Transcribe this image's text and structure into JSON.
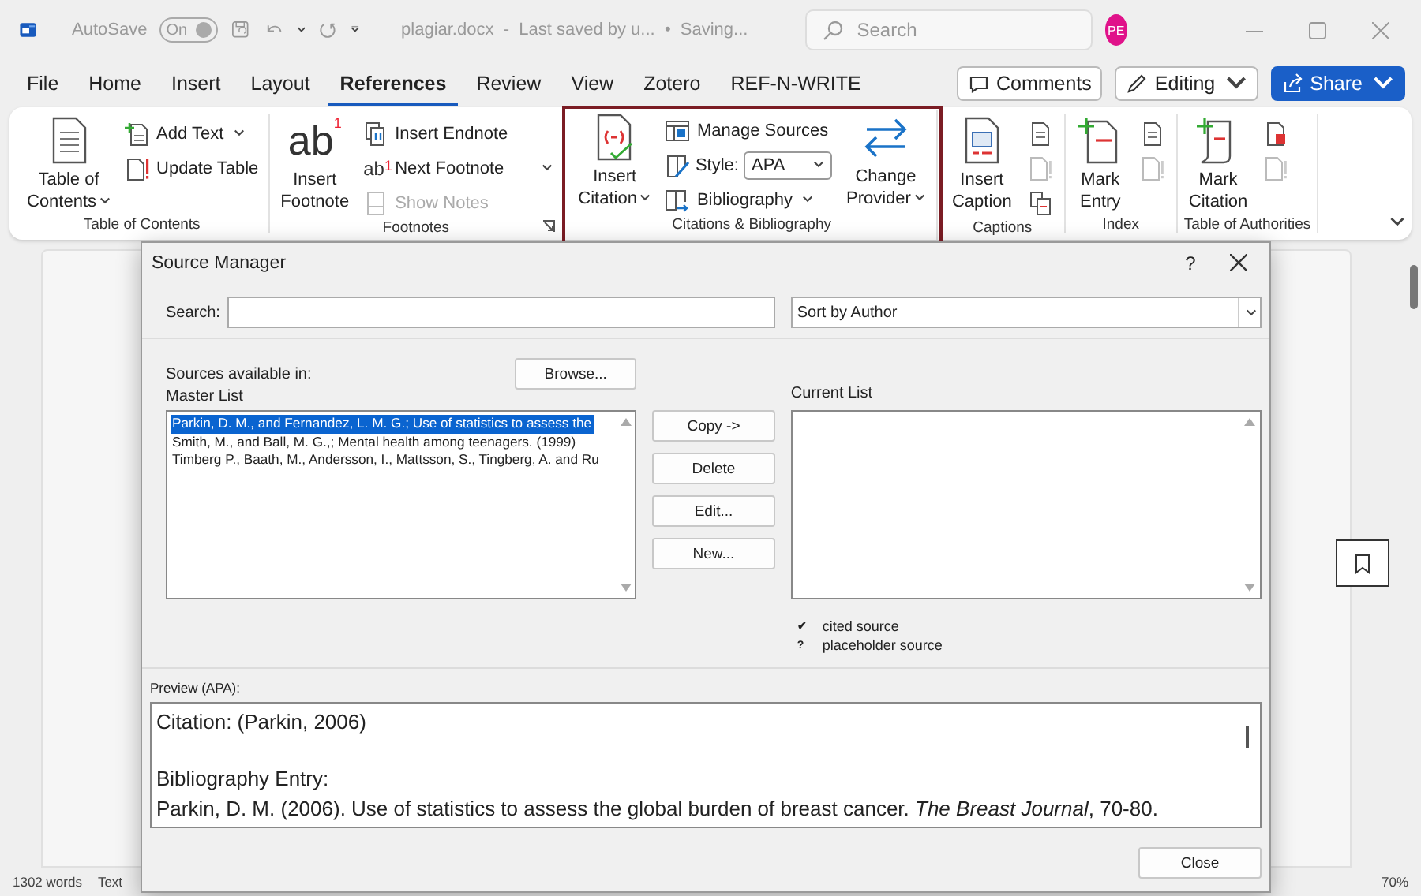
{
  "title_bar": {
    "autosave_label": "AutoSave",
    "autosave": {
      "label": "On",
      "on": true
    },
    "document_title": "plagiar.docx  -  Last saved by u...  •  Saving...",
    "search": {
      "placeholder": "Search"
    },
    "avatar": "PE"
  },
  "menu_tabs": [
    {
      "label": "File",
      "selected": false
    },
    {
      "label": "Home",
      "selected": false
    },
    {
      "label": "Insert",
      "selected": false
    },
    {
      "label": "Layout",
      "selected": false
    },
    {
      "label": "References",
      "selected": true
    },
    {
      "label": "Review",
      "selected": false
    },
    {
      "label": "View",
      "selected": false
    },
    {
      "label": "Zotero",
      "selected": false
    },
    {
      "label": "REF-N-WRITE",
      "selected": false
    }
  ],
  "actions": [
    {
      "kind": "comments",
      "label": "Comments"
    },
    {
      "kind": "mode",
      "label": "Editing"
    },
    {
      "kind": "share",
      "label": "Share"
    }
  ],
  "ribbon": {
    "groups": [
      {
        "label": "Table of Contents",
        "highlighted": false,
        "launcher": false,
        "items": [
          {
            "kind": "large",
            "lines": [
              "Table of",
              "Contents"
            ],
            "has_dropdown": true,
            "disabled": false
          },
          {
            "kind": "small",
            "label": "Add Text",
            "has_dropdown": true,
            "disabled": false
          },
          {
            "kind": "small",
            "label": "Update Table",
            "has_dropdown": false,
            "disabled": false
          }
        ]
      },
      {
        "label": "Footnotes",
        "highlighted": false,
        "launcher": true,
        "items": [
          {
            "kind": "large",
            "glyph": "ab",
            "glyph_mark": "1",
            "lines": [
              "Insert",
              "Footnote"
            ],
            "has_dropdown": false,
            "disabled": false
          },
          {
            "kind": "small",
            "label": "Insert Endnote",
            "has_dropdown": false,
            "disabled": false
          },
          {
            "kind": "small",
            "glyph": "ab",
            "glyph_mark": "1",
            "label": "Next Footnote",
            "has_dropdown": true,
            "disabled": false
          },
          {
            "kind": "small",
            "label": "Show Notes",
            "has_dropdown": false,
            "disabled": true
          }
        ]
      },
      {
        "label": "Citations & Bibliography",
        "highlighted": true,
        "launcher": false,
        "items": [
          {
            "kind": "large",
            "lines": [
              "Insert",
              "Citation"
            ],
            "has_dropdown": true,
            "disabled": false
          },
          {
            "kind": "small",
            "label": "Manage Sources",
            "has_dropdown": false,
            "disabled": false
          },
          {
            "kind": "select",
            "label": "Style:",
            "value": "APA",
            "has_dropdown": true,
            "disabled": false
          },
          {
            "kind": "small",
            "label": "Bibliography",
            "has_dropdown": true,
            "disabled": false
          },
          {
            "kind": "large",
            "lines": [
              "Change",
              "Provider"
            ],
            "has_dropdown": true,
            "disabled": false
          }
        ]
      },
      {
        "label": "Captions",
        "highlighted": false,
        "launcher": false,
        "items": [
          {
            "kind": "large",
            "lines": [
              "Insert",
              "Caption"
            ],
            "has_dropdown": false,
            "disabled": false
          },
          {
            "kind": "icon",
            "disabled": false
          },
          {
            "kind": "icon",
            "disabled": true
          },
          {
            "kind": "icon",
            "disabled": false
          }
        ]
      },
      {
        "label": "Index",
        "highlighted": false,
        "launcher": false,
        "items": [
          {
            "kind": "large",
            "lines": [
              "Mark",
              "Entry"
            ],
            "has_dropdown": false,
            "disabled": false
          },
          {
            "kind": "icon",
            "disabled": false
          },
          {
            "kind": "icon",
            "disabled": true
          }
        ]
      },
      {
        "label": "Table of Authorities",
        "highlighted": false,
        "launcher": false,
        "items": [
          {
            "kind": "large",
            "lines": [
              "Mark",
              "Citation"
            ],
            "has_dropdown": false,
            "disabled": false
          },
          {
            "kind": "icon",
            "disabled": false
          },
          {
            "kind": "icon",
            "disabled": true
          }
        ]
      }
    ]
  },
  "dialog": {
    "title": "Source Manager",
    "help": "?",
    "search_label": "Search:",
    "sort": "Sort by Author",
    "sources_label": "Sources available in:",
    "master_label": "Master List",
    "browse": "Browse...",
    "master_list": [
      {
        "text": "Parkin, D. M., and Fernandez, L. M. G.; Use of statistics to assess the",
        "selected": true
      },
      {
        "text": "Smith, M., and Ball, M. G.,; Mental health among teenagers. (1999)",
        "selected": false
      },
      {
        "text": "Timberg P., Baath, M., Andersson, I., Mattsson, S., Tingberg, A. and Ru",
        "selected": false
      }
    ],
    "actions": [
      "Copy ->",
      "Delete",
      "Edit...",
      "New..."
    ],
    "current_label": "Current List",
    "legend": [
      {
        "mark": "✔",
        "label": "cited source"
      },
      {
        "mark": "?",
        "label": "placeholder source"
      }
    ],
    "preview_label": "Preview (APA):",
    "preview": {
      "citation": "Citation:  (Parkin, 2006)",
      "entry_label": "Bibliography Entry:",
      "entry": "Parkin, D. M. (2006). Use of statistics to assess the global burden of breast cancer. *The Breast Journal*, 70-80."
    },
    "close": "Close"
  },
  "status_bar": {
    "words": "1302 words",
    "mode": "Text",
    "zoom": "70%"
  }
}
